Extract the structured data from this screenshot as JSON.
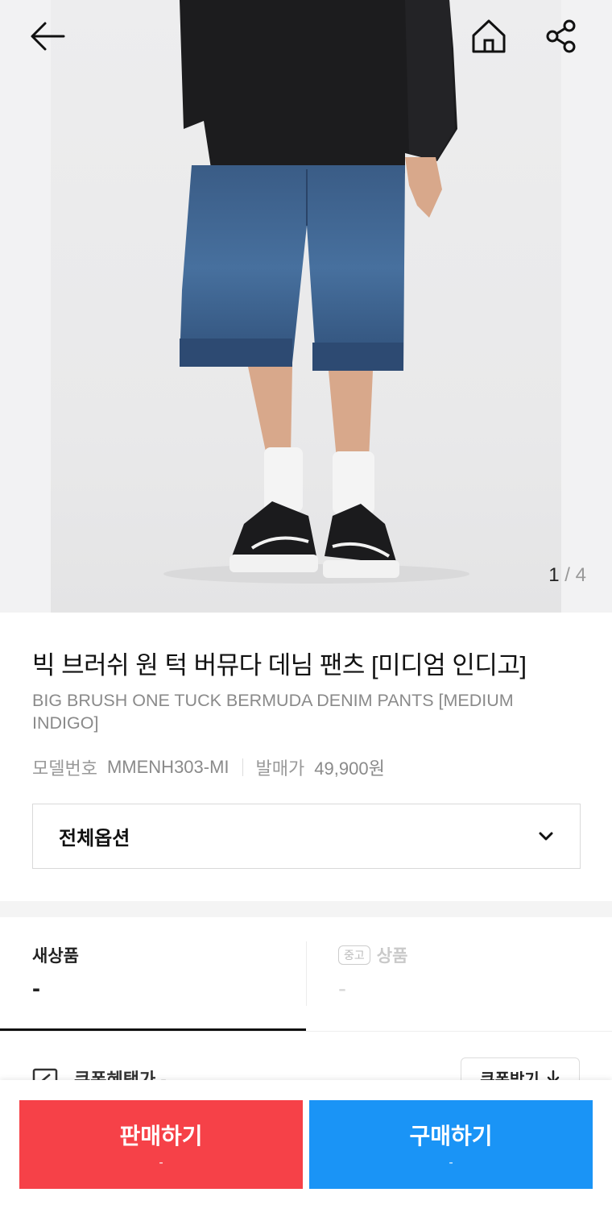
{
  "hero": {
    "image_counter": {
      "current": "1",
      "separator": "/",
      "total": "4"
    }
  },
  "icons": {
    "back": "arrow-left-icon",
    "home": "home-icon",
    "share": "share-icon",
    "dropdown": "chevron-down-icon",
    "coupon": "coupon-icon",
    "download": "download-icon"
  },
  "product": {
    "title": "빅 브러쉬 원 턱 버뮤다 데님 팬츠 [미디엄 인디고]",
    "subtitle": "BIG BRUSH ONE TUCK BERMUDA DENIM PANTS [MEDIUM INDIGO]",
    "model_label": "모델번호",
    "model_value": "MMENH303-MI",
    "release_price_label": "발매가",
    "release_price_value": "49,900원"
  },
  "option_select": {
    "label": "전체옵션"
  },
  "tabs": [
    {
      "title": "새상품",
      "price": "-"
    },
    {
      "badge": "중고",
      "title": "상품",
      "price": "-"
    }
  ],
  "coupon": {
    "label": "쿠폰혜택가 -",
    "button_label": "쿠폰받기"
  },
  "actions": {
    "sell": {
      "label": "판매하기",
      "sub": "-"
    },
    "buy": {
      "label": "구매하기",
      "sub": "-"
    }
  },
  "colors": {
    "sell": "#f64148",
    "buy": "#1a94f6"
  }
}
